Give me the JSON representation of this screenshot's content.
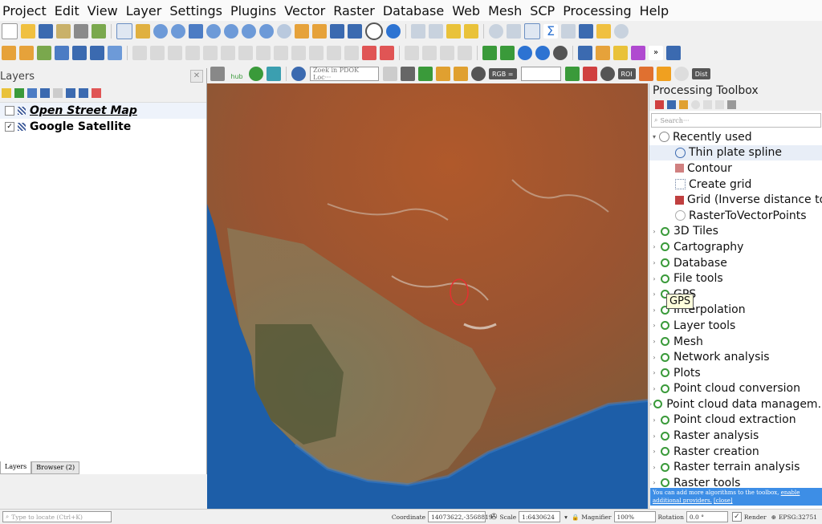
{
  "menubar": [
    "Project",
    "Edit",
    "View",
    "Layer",
    "Settings",
    "Plugins",
    "Vector",
    "Raster",
    "Database",
    "Web",
    "Mesh",
    "SCP",
    "Processing",
    "Help"
  ],
  "toolbar3": {
    "search_placeholder": "Zoek in PDOK Loc···",
    "hub_label": "hub",
    "rgb_label": "RGB =",
    "roi_label": "ROI",
    "dist_label": "Dist"
  },
  "layers_panel": {
    "title": "Layers",
    "items": [
      {
        "name": "Open Street Map",
        "checked": false
      },
      {
        "name": "Google Satellite",
        "checked": true
      }
    ],
    "tabs": [
      "Layers",
      "Browser (2)"
    ]
  },
  "toolbox": {
    "title": "Processing Toolbox",
    "search_placeholder": "Search···",
    "recently_used_label": "Recently used",
    "recent_items": [
      "Thin plate spline",
      "Contour",
      "Create grid",
      "Grid (Inverse distance to ...",
      "RasterToVectorPoints"
    ],
    "groups": [
      "3D Tiles",
      "Cartography",
      "Database",
      "File tools",
      "GPS",
      "Interpolation",
      "Layer tools",
      "Mesh",
      "Network analysis",
      "Plots",
      "Point cloud conversion",
      "Point cloud data managem...",
      "Point cloud extraction",
      "Raster analysis",
      "Raster creation",
      "Raster terrain analysis",
      "Raster tools"
    ],
    "tooltip": "GPS",
    "notice_text": "You can add more algorithms to the toolbox,",
    "notice_link": "enable additional providers.",
    "notice_close": "[close]"
  },
  "statusbar": {
    "locate_placeholder": "Type to locate (Ctrl+K)",
    "coordinate_label": "Coordinate",
    "coordinate_value": "14073622,-3568819",
    "scale_label": "Scale",
    "scale_value": "1:6430624",
    "magnifier_label": "Magnifier",
    "magnifier_value": "100%",
    "rotation_label": "Rotation",
    "rotation_value": "0.0 °",
    "render_label": "Render",
    "crs": "EPSG:32751"
  },
  "colors": {
    "accent": "#3d8ee6",
    "green": "#3a9a3a",
    "land": "#a8552e",
    "ocean": "#1d5ea8"
  }
}
